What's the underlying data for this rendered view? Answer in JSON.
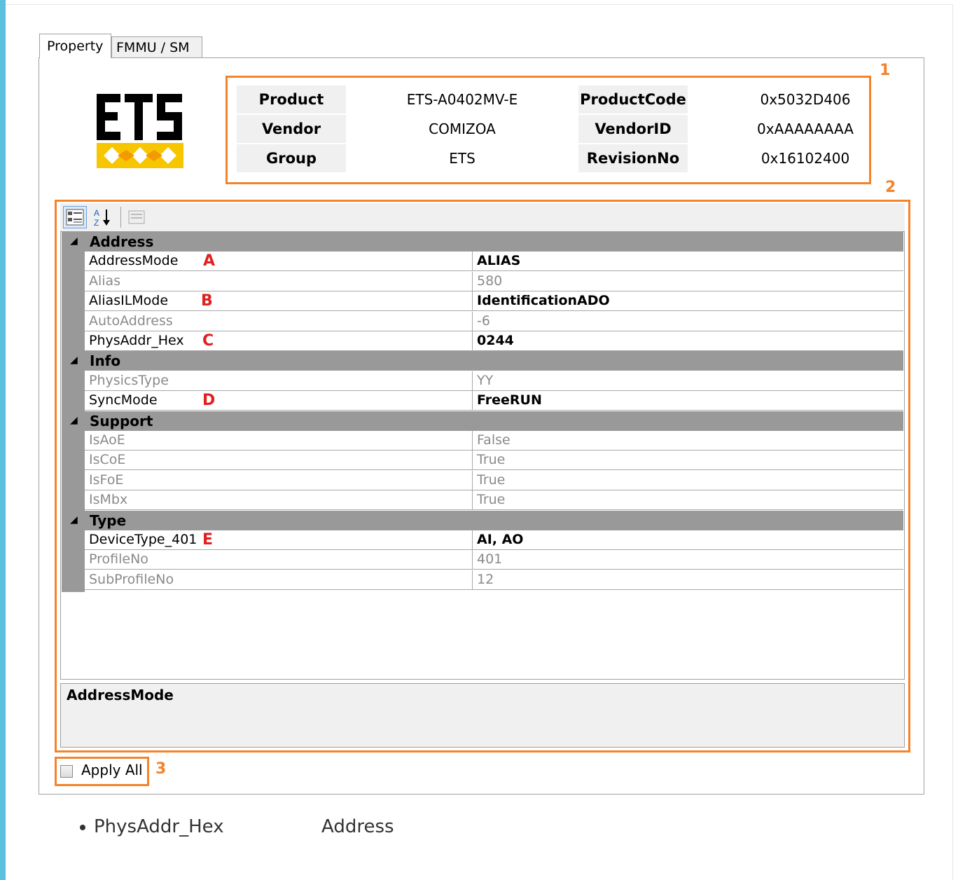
{
  "tabs": [
    {
      "label": "Property",
      "active": true
    },
    {
      "label": "FMMU / SM",
      "active": false
    }
  ],
  "callouts": {
    "one": "1",
    "two": "2",
    "three": "3"
  },
  "logo": {
    "text": "ETS",
    "colors": [
      "#000000",
      "#f7c600",
      "#ffffff"
    ]
  },
  "info": {
    "product_label": "Product",
    "product_value": "ETS-A0402MV-E",
    "vendor_label": "Vendor",
    "vendor_value": "COMIZOA",
    "group_label": "Group",
    "group_value": "ETS",
    "productcode_label": "ProductCode",
    "productcode_value": "0x5032D406",
    "vendorid_label": "VendorID",
    "vendorid_value": "0xAAAAAAAA",
    "revision_label": "RevisionNo",
    "revision_value": "0x16102400"
  },
  "toolbar": {
    "categorized_icon": "categorized-icon",
    "alphabetical_icon": "sort-az-icon",
    "property_pages_icon": "property-pages-icon"
  },
  "grid": {
    "categories": [
      {
        "label": "Address",
        "rows": [
          {
            "name": "AddressMode",
            "value": "ALIAS",
            "readonly": false,
            "marker": "A"
          },
          {
            "name": "Alias",
            "value": "580",
            "readonly": true
          },
          {
            "name": "AliasILMode",
            "value": "IdentificationADO",
            "readonly": false,
            "marker": "B"
          },
          {
            "name": "AutoAddress",
            "value": "-6",
            "readonly": true
          },
          {
            "name": "PhysAddr_Hex",
            "value": "0244",
            "readonly": false,
            "marker": "C"
          }
        ]
      },
      {
        "label": "Info",
        "rows": [
          {
            "name": "PhysicsType",
            "value": "YY",
            "readonly": true
          },
          {
            "name": "SyncMode",
            "value": "FreeRUN",
            "readonly": false,
            "marker": "D"
          }
        ]
      },
      {
        "label": "Support",
        "rows": [
          {
            "name": "IsAoE",
            "value": "False",
            "readonly": true
          },
          {
            "name": "IsCoE",
            "value": "True",
            "readonly": true
          },
          {
            "name": "IsFoE",
            "value": "True",
            "readonly": true
          },
          {
            "name": "IsMbx",
            "value": "True",
            "readonly": true
          }
        ]
      },
      {
        "label": "Type",
        "rows": [
          {
            "name": "DeviceType_401",
            "value": "AI, AO",
            "readonly": false,
            "marker": "E"
          },
          {
            "name": "ProfileNo",
            "value": "401",
            "readonly": true
          },
          {
            "name": "SubProfileNo",
            "value": "12",
            "readonly": true
          }
        ]
      }
    ]
  },
  "description": {
    "title": "AddressMode"
  },
  "apply_all": {
    "label": "Apply All",
    "checked": false
  },
  "bullet": {
    "text1": "PhysAddr_Hex",
    "text2": "Address"
  },
  "colors": {
    "accent_orange": "#f5832a",
    "marker_red": "#e02020",
    "category_gray": "#999999",
    "left_bar": "#5bc0de"
  }
}
